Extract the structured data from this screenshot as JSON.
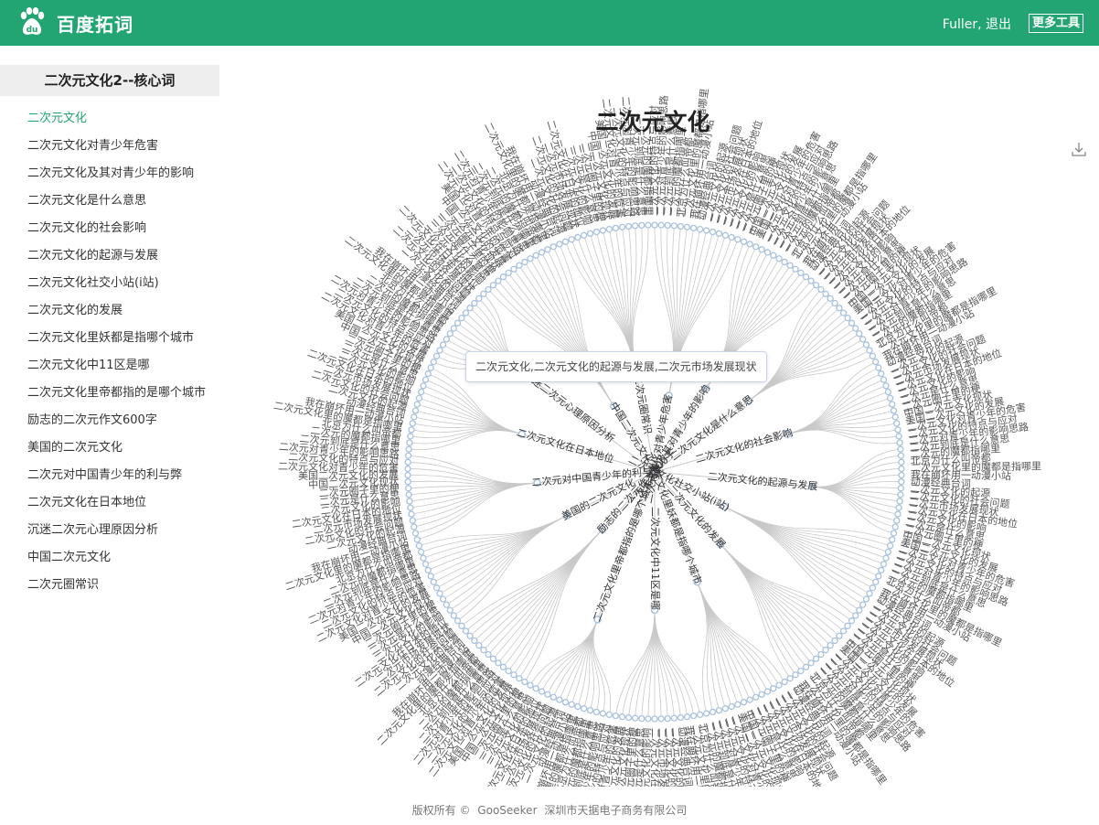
{
  "header": {
    "brand": "百度拓词",
    "user_text": "Fuller, 退出",
    "more_tools": "更多工具",
    "logo_icon": "baidu-paw-icon",
    "color": "#22a572"
  },
  "sidebar": {
    "title": "二次元文化2--核心词",
    "items": [
      "二次元文化",
      "二次元文化对青少年危害",
      "二次元文化及其对青少年的影响",
      "二次元文化是什么意思",
      "二次元文化的社会影响",
      "二次元文化的起源与发展",
      "二次元文化社交小站(i站)",
      "二次元文化的发展",
      "二次元文化里妖都是指哪个城市",
      "二次元文化中11区是哪",
      "二次元文化里帝都指的是哪个城市",
      "励志的二次元作文600字",
      "美国的二次元文化",
      "二次元对中国青少年的利与弊",
      "二次元文化在日本地位",
      "沉迷二次元心理原因分析",
      "中国二次元文化",
      "二次元圈常识"
    ],
    "active_index": 0
  },
  "chart": {
    "title": "二次元文化",
    "download_icon": "download-icon",
    "tooltip": "二次元文化,二次元文化的起源与发展,二次元市场发展现状"
  },
  "footer": {
    "copyright": "版权所有 ©",
    "company_en": "GooSeeker",
    "company_cn": "深圳市天据电子商务有限公司"
  },
  "chart_data": {
    "type": "radial-tree",
    "root": "二次元文化",
    "branches": [
      "二次元文化对青少年危害",
      "二次元文化及其对青少年的影响",
      "二次元文化是什么意思",
      "二次元文化的社会影响",
      "二次元文化的起源与发展",
      "二次元文化社交小站(i站)",
      "二次元文化的发展",
      "二次元文化里妖都是指哪个城市",
      "二次元文化中11区是哪",
      "二次元文化里帝都指的是哪个城市",
      "励志的二次元作文600字",
      "美国的二次元文化",
      "二次元对中国青少年的利与弊",
      "二次元文化在日本地位",
      "沉迷二次元心理原因分析",
      "中国二次元文化",
      "二次元圈常识"
    ],
    "leaf_labels": [
      "二次元文化的特点与应对",
      "二次元对青少年的影响思路",
      "二次元到底是什么意思",
      "二次元的魔都指哪里",
      "北京为什么叫帝都",
      "二次元文化里的魔都是指哪里",
      "我在崩坏用一动漫小站",
      "动漫经典台词",
      "二次元文化的起源",
      "二次元文化的社会问题",
      "二次元市场发展现状",
      "二次元文化在日本的地位",
      "二次元文化的影响",
      "二次元是什么意思",
      "二次元圈子里的梗",
      "中国二次元文化现状",
      "美国二次元文化的发展",
      "二次元文化对青少年的危害"
    ],
    "node_color": "#a9c1dd",
    "link_color": "#c8c8c8"
  }
}
